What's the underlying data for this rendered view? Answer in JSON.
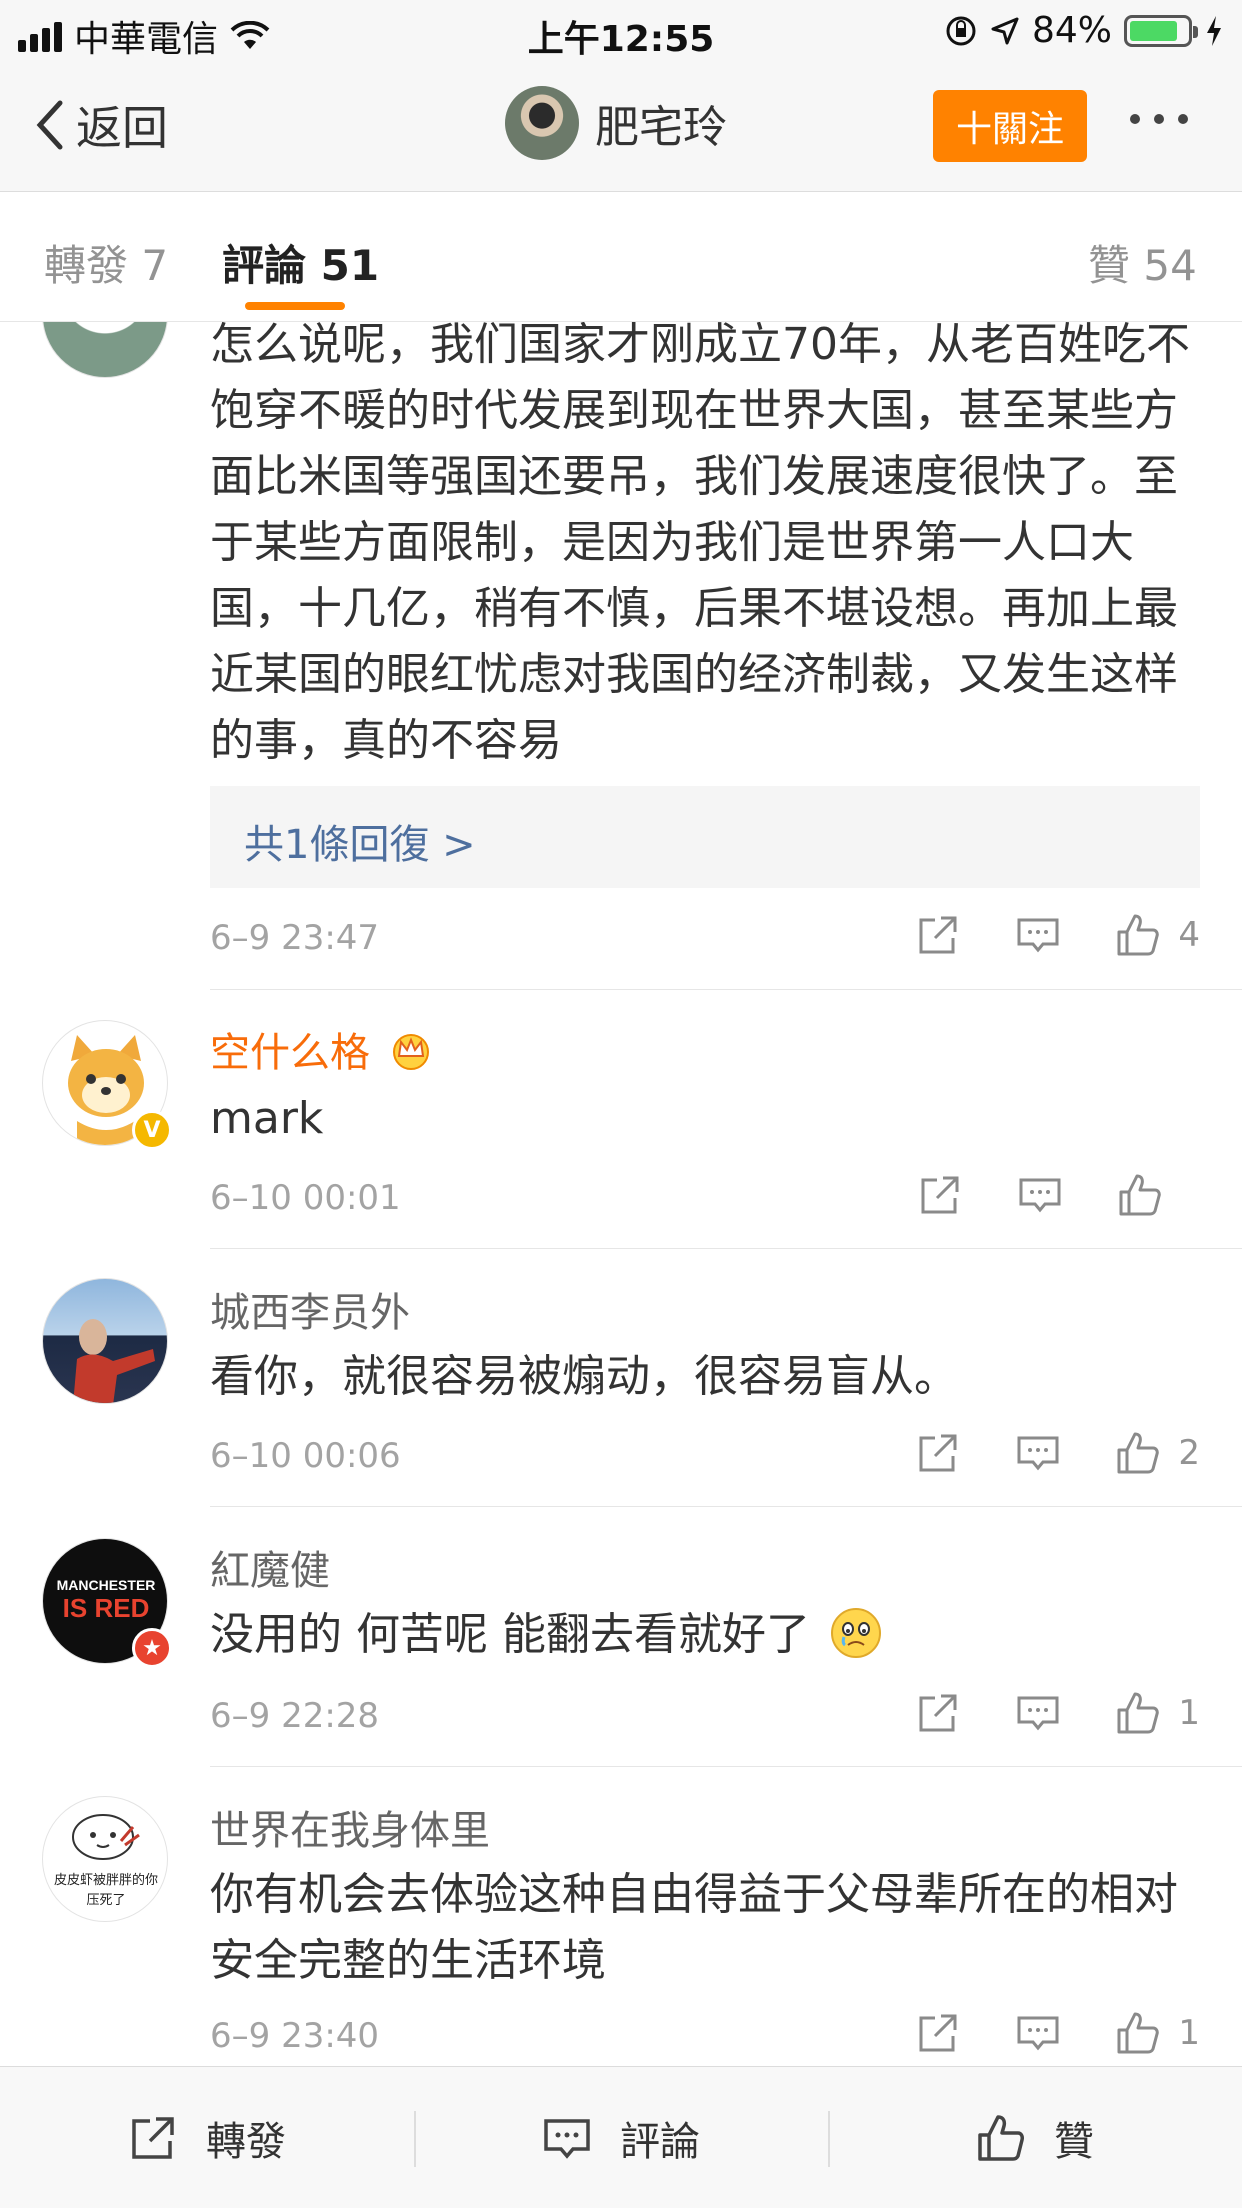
{
  "status_bar": {
    "carrier": "中華電信",
    "time": "上午12:55",
    "battery": "84%",
    "battery_level": 0.84
  },
  "nav": {
    "back_label": "返回",
    "title": "肥宅玲",
    "follow_label": "十關注"
  },
  "tabs": {
    "repost": "轉發 7",
    "comments": "評論 51",
    "likes": "贊 54"
  },
  "comments": [
    {
      "username": "",
      "text": "怎么说呢，我们国家才刚成立70年，从老百姓吃不饱穿不暖的时代发展到现在世界大国，甚至某些方面比米国等强国还要吊，我们发展速度很快了。至于某些方面限制，是因为我们是世界第一人口大国，十几亿，稍有不慎，后果不堪设想。再加上最近某国的眼红忧虑对我国的经济制裁，又发生这样的事，真的不容易",
      "reply_link": "共1條回復 >",
      "time": "6–9 23:47",
      "likes": "4"
    },
    {
      "username": "空什么格",
      "text": "mark",
      "time": "6–10 00:01",
      "likes": ""
    },
    {
      "username": "城西李员外",
      "text": "看你，就很容易被煽动，很容易盲从。",
      "time": "6–10 00:06",
      "likes": "2"
    },
    {
      "username": "紅魔健",
      "text": "没用的 何苦呢 能翻去看就好了",
      "time": "6–9 22:28",
      "likes": "1",
      "avatar_text": [
        "MANCHESTER",
        "IS RED"
      ]
    },
    {
      "username": "世界在我身体里",
      "text": "你有机会去体验这种自由得益于父母辈所在的相对安全完整的生活环境",
      "time": "6–9 23:40",
      "likes": "1",
      "avatar_text": [
        "皮皮虾被胖胖的你",
        "压死了"
      ]
    }
  ],
  "bottom_bar": {
    "repost": "轉發",
    "comment": "評論",
    "like": "贊"
  },
  "colors": {
    "accent": "#ff8200",
    "link": "#4e6f9e",
    "vip_name": "#f86c0a"
  }
}
